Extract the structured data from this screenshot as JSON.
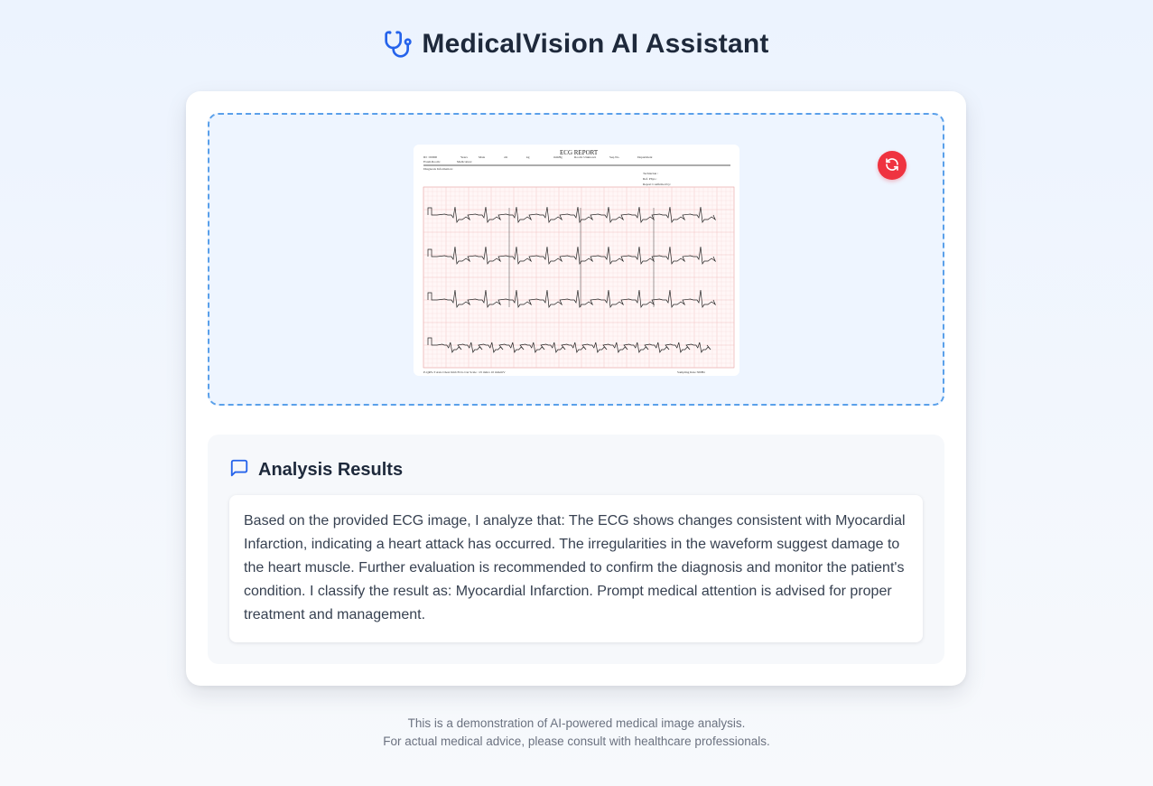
{
  "app": {
    "title": "MedicalVision AI Assistant",
    "logo_icon": "stethoscope-icon"
  },
  "upload": {
    "reset_icon": "refresh-icon",
    "image_icon": "ecg-report-image"
  },
  "results": {
    "icon": "chat-bubble-icon",
    "heading": "Analysis Results",
    "text": "Based on the provided ECG image, I analyze that: The ECG shows changes consistent with Myocardial Infarction, indicating a heart attack has occurred. The irregularities in the waveform suggest damage to the heart muscle. Further evaluation is recommended to confirm the diagnosis and monitor the patient's condition. I classify the result as: Myocardial Infarction. Prompt medical attention is advised for proper treatment and management."
  },
  "footer": {
    "line1": "This is a demonstration of AI-powered medical image analysis.",
    "line2": "For actual medical advice, please consult with healthcare professionals."
  },
  "colors": {
    "accent_blue": "#2563eb",
    "reset_red": "#ef3340",
    "dropzone_border": "#5aa0ea"
  }
}
